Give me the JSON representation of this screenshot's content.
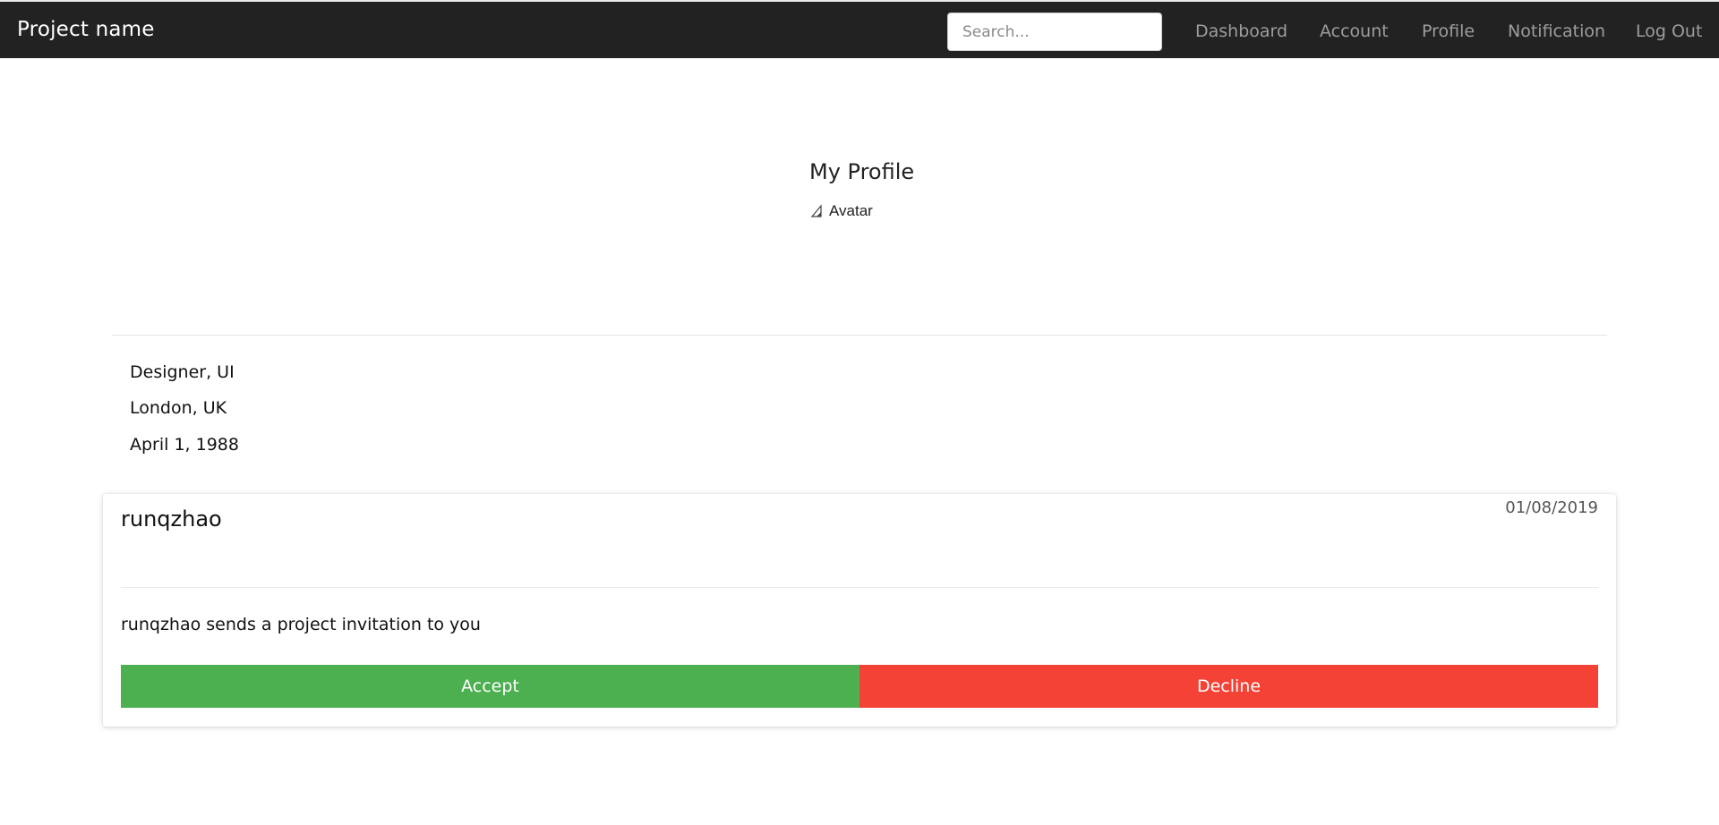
{
  "navbar": {
    "brand": "Project name",
    "search_placeholder": "Search...",
    "links": [
      "Dashboard",
      "Account",
      "Profile",
      "Notification",
      "Log Out"
    ]
  },
  "profile": {
    "title": "My Profile",
    "avatar_alt": "Avatar",
    "role": "Designer, UI",
    "location": "London, UK",
    "birthday": "April 1, 1988"
  },
  "notification": {
    "user": "runqzhao",
    "date": "01/08/2019",
    "message": "runqzhao sends a project invitation to you",
    "accept_label": "Accept",
    "decline_label": "Decline"
  },
  "colors": {
    "navbar_bg": "#222222",
    "accept": "#4caf50",
    "decline": "#f44336"
  },
  "icons": {
    "avatar": "broken-image-icon"
  }
}
